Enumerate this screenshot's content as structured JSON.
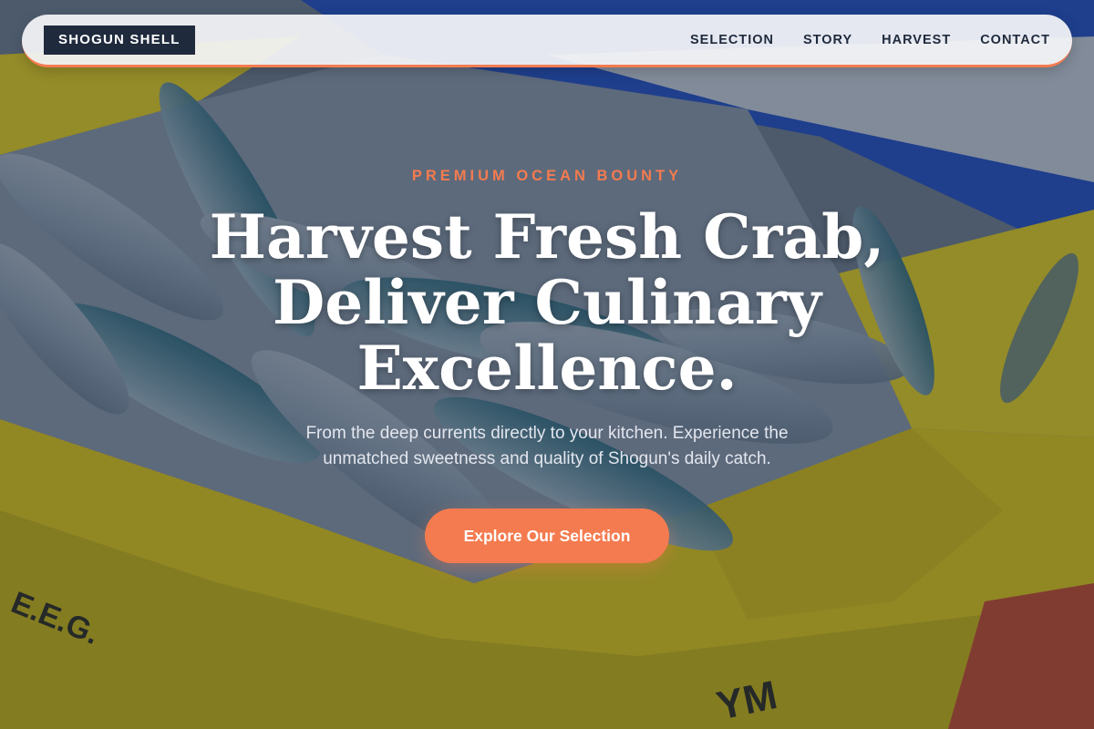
{
  "nav": {
    "brand": "SHOGUN SHELL",
    "links": [
      "SELECTION",
      "STORY",
      "HARVEST",
      "CONTACT"
    ]
  },
  "hero": {
    "eyebrow": "PREMIUM OCEAN BOUNTY",
    "headline": "Harvest Fresh Crab, Deliver Culinary Excellence.",
    "subtext": "From the deep currents directly to your kitchen. Experience the unmatched sweetness and quality of Shogun's daily catch.",
    "cta_label": "Explore Our Selection",
    "background_image": "fish-crates-photo"
  },
  "colors": {
    "accent": "#f47b4f",
    "navy": "#1f2a3d",
    "crate_yellow": "#e8d21c",
    "crate_blue": "#1f4fc7"
  }
}
